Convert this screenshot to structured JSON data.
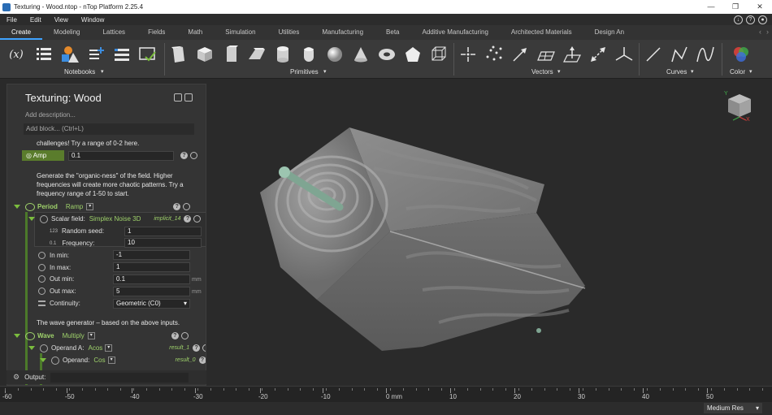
{
  "window": {
    "title": "Texturing - Wood.ntop - nTop Platform 2.25.4"
  },
  "menu": [
    "File",
    "Edit",
    "View",
    "Window"
  ],
  "tabs": [
    "Create",
    "Modeling",
    "Lattices",
    "Fields",
    "Math",
    "Simulation",
    "Utilities",
    "Manufacturing",
    "Beta",
    "Additive Manufacturing",
    "Architected Materials",
    "Design An"
  ],
  "toolbar_groups": {
    "notebooks": "Notebooks",
    "primitives": "Primitives",
    "vectors": "Vectors",
    "curves": "Curves",
    "color": "Color"
  },
  "panel": {
    "title": "Texturing: Wood",
    "description_placeholder": "Add description...",
    "add_block_placeholder": "Add block... (Ctrl+L)",
    "note1": "challenges! Try a range of 0-2 here.",
    "amp": {
      "label": "Amp",
      "value": "0.1"
    },
    "note2": [
      "Generate the \"organic-ness\" of the field. Higher",
      "frequencies will create more chaotic patterns. Try a",
      "frequency range of 1-50 to start."
    ],
    "period": {
      "label": "Period",
      "type": "Ramp"
    },
    "scalar": {
      "label": "Scalar field:",
      "value": "Simplex Noise 3D",
      "ref": "implicit_14"
    },
    "seed": {
      "icon": "123",
      "label": "Random seed:",
      "value": "1"
    },
    "freq": {
      "icon": "0.1",
      "label": "Frequency:",
      "value": "10"
    },
    "in_min": {
      "label": "In min:",
      "value": "-1"
    },
    "in_max": {
      "label": "In max:",
      "value": "1"
    },
    "out_min": {
      "label": "Out min:",
      "value": "0.1",
      "unit": "mm"
    },
    "out_max": {
      "label": "Out max:",
      "value": "5",
      "unit": "mm"
    },
    "continuity": {
      "label": "Continuity:",
      "value": "Geometric (C0)"
    },
    "note3": "The wave generator – based on the above inputs.",
    "wave": {
      "label": "Wave",
      "type": "Multiply"
    },
    "operand_a": {
      "label": "Operand A:",
      "value": "Acos",
      "ref": "result_1"
    },
    "operand": {
      "label": "Operand:",
      "value": "Cos",
      "ref": "result_0"
    },
    "output_label": "Output:"
  },
  "ruler": {
    "labels": [
      "-60",
      "-50",
      "-40",
      "-30",
      "-20",
      "-10",
      "0 mm",
      "10",
      "20",
      "30",
      "40",
      "50"
    ]
  },
  "status": {
    "resolution": "Medium Res"
  },
  "viewcube": {
    "axis_x": "X",
    "axis_y": "Y"
  }
}
